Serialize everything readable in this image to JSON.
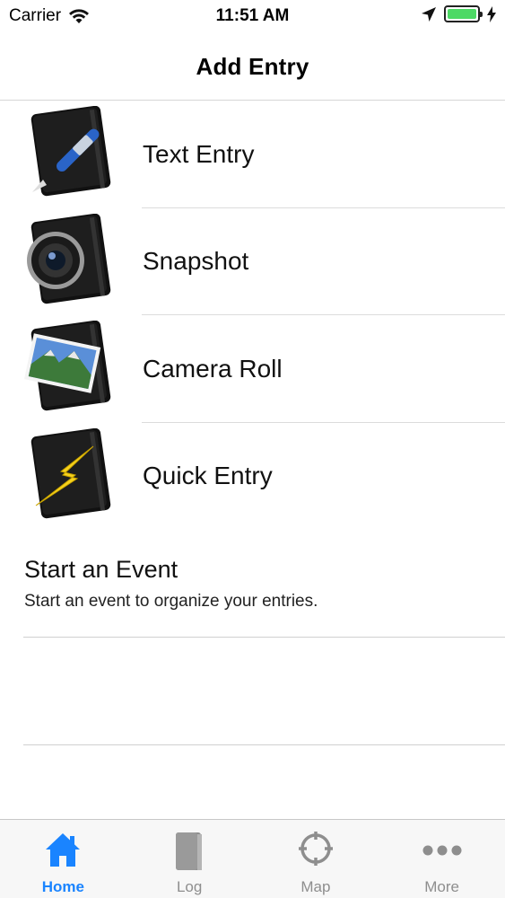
{
  "status_bar": {
    "carrier": "Carrier",
    "time": "11:51 AM",
    "battery_level": 1.0,
    "icons": [
      "wifi-icon",
      "location-arrow-icon",
      "battery-icon",
      "charging-bolt-icon"
    ]
  },
  "nav": {
    "title": "Add Entry"
  },
  "entries": [
    {
      "label": "Text Entry",
      "icon": "notebook-pen-icon"
    },
    {
      "label": "Snapshot",
      "icon": "notebook-camera-icon"
    },
    {
      "label": "Camera Roll",
      "icon": "notebook-photo-icon"
    },
    {
      "label": "Quick Entry",
      "icon": "notebook-lightning-icon"
    }
  ],
  "event": {
    "title": "Start an Event",
    "subtitle": "Start an event to organize your entries."
  },
  "tabs": [
    {
      "label": "Home",
      "icon": "home-icon",
      "active": true
    },
    {
      "label": "Log",
      "icon": "book-icon",
      "active": false
    },
    {
      "label": "Map",
      "icon": "crosshair-icon",
      "active": false
    },
    {
      "label": "More",
      "icon": "ellipsis-icon",
      "active": false
    }
  ],
  "colors": {
    "accent": "#1a84ff",
    "battery": "#4cd964",
    "inactive_tab": "#8e8e8e"
  }
}
